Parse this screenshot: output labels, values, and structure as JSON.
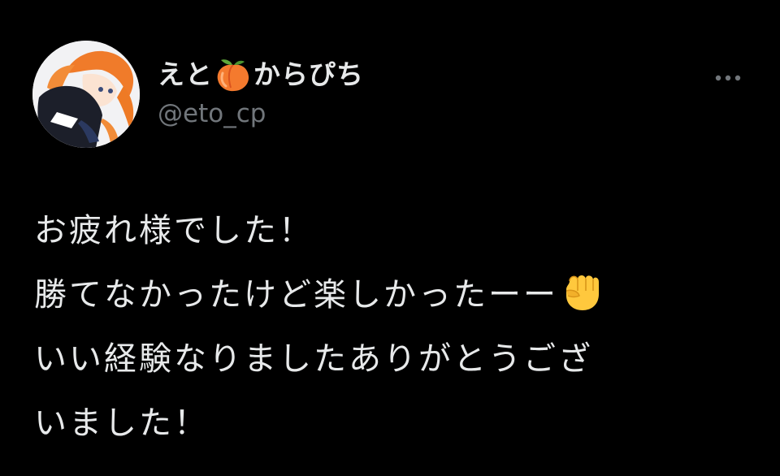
{
  "tweet": {
    "author": {
      "name_part1": "えと",
      "name_emoji": "peach-emoji",
      "name_part2": "からぴち",
      "handle": "@eto_cp",
      "avatar": "profile-avatar"
    },
    "more_icon": "more-dots-icon",
    "text": {
      "line1": "お疲れ様でした！",
      "line2": "勝てなかったけど楽しかったーー",
      "line2_emoji": "raised-fist-emoji",
      "line3": "いい経験なりましたありがとうござ",
      "line4": "いました！"
    }
  },
  "colors": {
    "background": "#000000",
    "primary_text": "#e7e9ea",
    "secondary_text": "#71767b"
  }
}
